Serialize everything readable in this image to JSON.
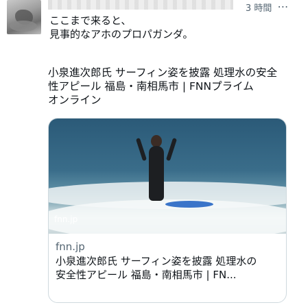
{
  "tweet": {
    "timestamp": "3 時間",
    "more_icon": "more-horizontal-icon",
    "text_lines": [
      "ここまで来ると、",
      "見事的なアホのプロパガンダ。"
    ],
    "quote_lines": [
      "小泉進次郎氏 サーフィン姿を披露 処理水の安全",
      "性アピール 福島・南相馬市 | FNNプライム",
      "オンライン"
    ]
  },
  "card": {
    "image_tag": "fnn.jp",
    "domain": "fnn.jp",
    "title_lines": [
      "小泉進次郎氏 サーフィン姿を披露 処理水の",
      "安全性アピール 福島・南相馬市 | FN..."
    ]
  }
}
